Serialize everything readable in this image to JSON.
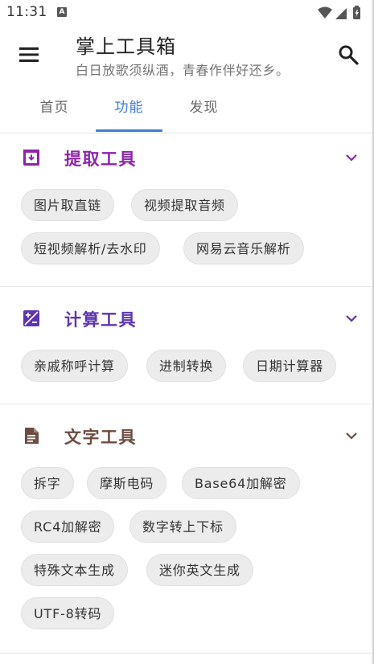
{
  "status": {
    "time": "11:31",
    "a_badge": "A"
  },
  "app": {
    "title": "掌上工具箱",
    "subtitle": "白日放歌须纵酒，青春作伴好还乡。"
  },
  "tabs": [
    {
      "label": "首页",
      "active": false
    },
    {
      "label": "功能",
      "active": true
    },
    {
      "label": "发现",
      "active": false
    }
  ],
  "sections": [
    {
      "title": "提取工具",
      "color": "#8e24aa",
      "icon": "archive-icon",
      "chips": [
        "图片取直链",
        "视频提取音频",
        "短视频解析/去水印",
        "网易云音乐解析"
      ]
    },
    {
      "title": "计算工具",
      "color": "#5e35b1",
      "icon": "calculator-icon",
      "chips": [
        "亲戚称呼计算",
        "进制转换",
        "日期计算器"
      ]
    },
    {
      "title": "文字工具",
      "color": "#6d4c41",
      "icon": "document-icon",
      "chips": [
        "拆字",
        "摩斯电码",
        "Base64加解密",
        "RC4加解密",
        "数字转上下标",
        "特殊文本生成",
        "迷你英文生成",
        "UTF-8转码"
      ]
    }
  ],
  "colors": {
    "accent": "#3f7bd8",
    "chip_bg": "#ececec"
  }
}
